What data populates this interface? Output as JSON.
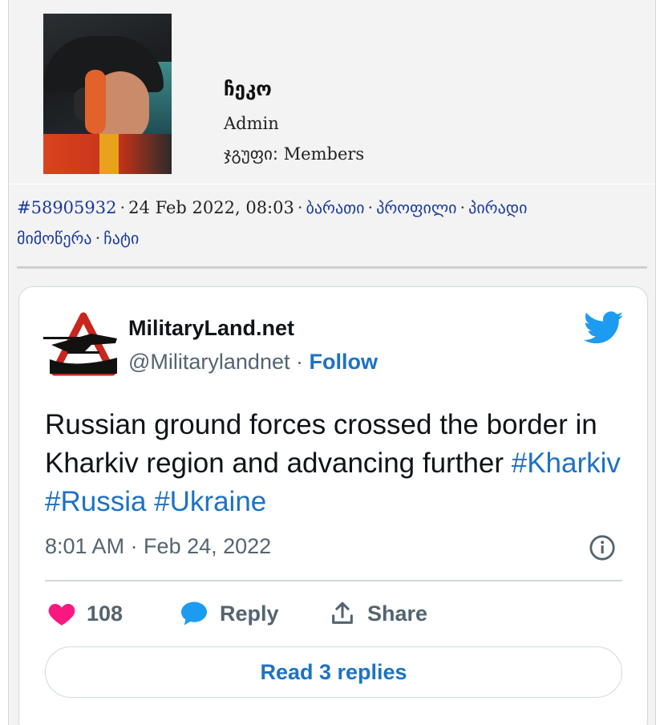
{
  "post": {
    "username": "ჩეკო",
    "role": "Admin",
    "group_label": "ჯგუფი:",
    "group_value": "Members",
    "post_id": "#58905932",
    "date": "24 Feb 2022, 08:03",
    "links": [
      "ბარათი",
      "პროფილი",
      "პირადი მიმოწერა",
      "ჩატი"
    ]
  },
  "tweet": {
    "display_name": "MilitaryLand.net",
    "handle": "@Militarylandnet",
    "dot": "·",
    "follow_label": "Follow",
    "text_main": "Russian ground forces crossed the border in Kharkiv region and advancing further",
    "hashtags": [
      "#Kharkiv",
      "#Russia",
      "#Ukraine"
    ],
    "timestamp": "8:01 AM · Feb 24, 2022",
    "likes": "108",
    "reply_label": "Reply",
    "share_label": "Share",
    "read_replies_label": "Read 3 replies"
  },
  "colors": {
    "link": "#1a3a9c",
    "twitter_blue": "#1d9bf0",
    "like_pink": "#f91880",
    "muted": "#536471"
  },
  "icons": [
    "twitter-bird-icon",
    "heart-icon",
    "reply-bubble-icon",
    "share-icon",
    "info-icon"
  ]
}
